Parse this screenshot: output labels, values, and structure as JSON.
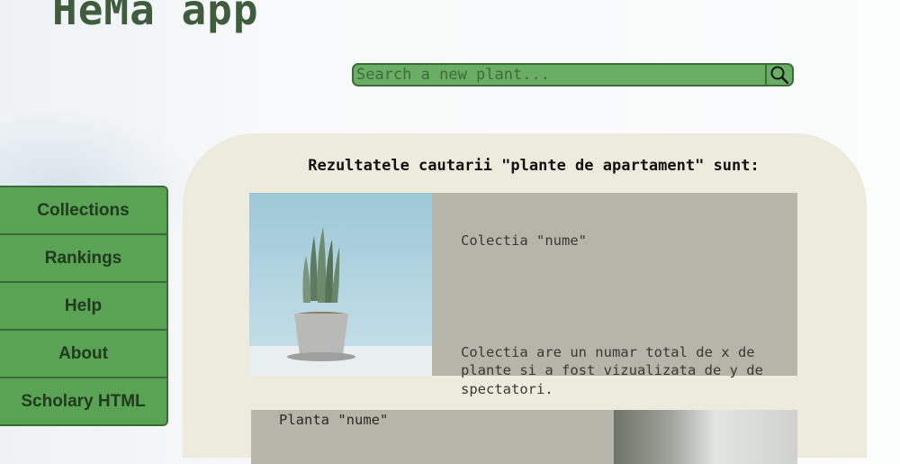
{
  "header": {
    "app_title": "HeMa app"
  },
  "search": {
    "placeholder": "Search a new plant...",
    "value": ""
  },
  "sidebar": {
    "items": [
      {
        "label": "Collections"
      },
      {
        "label": "Rankings"
      },
      {
        "label": "Help"
      },
      {
        "label": "About"
      },
      {
        "label": "Scholary HTML"
      }
    ]
  },
  "results": {
    "heading": "Rezultatele cautarii \"plante de apartament\" sunt:",
    "collection_card": {
      "title": "Colectia \"nume\"",
      "description": "Colectia are un numar total de x de plante si a fost vizualizata de y de spectatori."
    },
    "plant_card": {
      "title": "Planta \"nume\""
    }
  },
  "colors": {
    "accent_green": "#6aae65",
    "nav_green": "#5aa254",
    "dark_green": "#3f5c3d",
    "panel_beige": "#ecebdd",
    "card_gray": "#b6b5a9"
  }
}
